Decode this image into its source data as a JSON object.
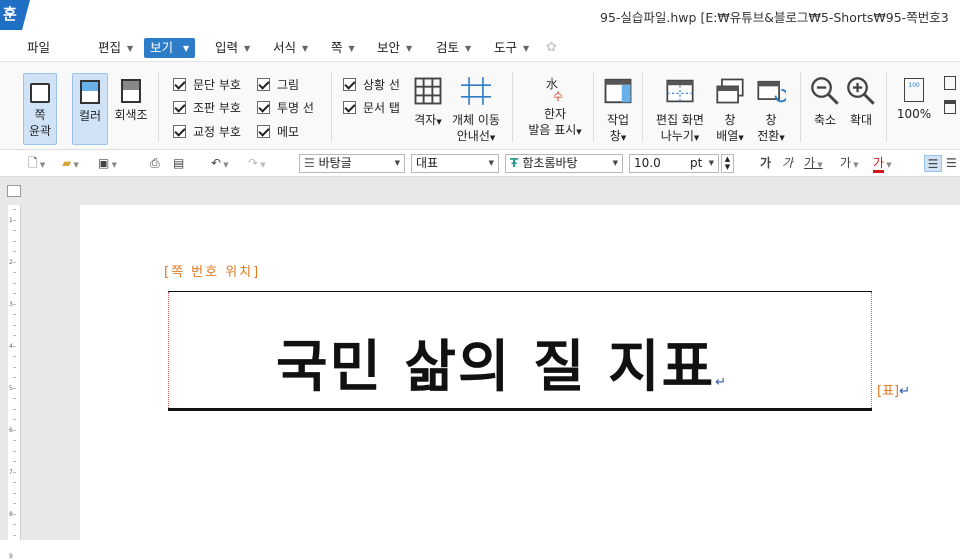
{
  "app": {
    "logo": "훈",
    "window_title": "95-실습파일.hwp [E:₩유튜브&블로그₩5-Shorts₩95-쪽번호3"
  },
  "menu": [
    "파일",
    "편집",
    "보기",
    "입력",
    "서식",
    "쪽",
    "보안",
    "검토",
    "도구"
  ],
  "ribbon": {
    "page_outline": [
      "쪽",
      "윤곽"
    ],
    "color": "컬러",
    "grayscale": "회색조",
    "checks_col1": [
      "문단 부호",
      "조판 부호",
      "교정 부호"
    ],
    "checks_col2": [
      "그림",
      "투명 선",
      "메모"
    ],
    "checks_col3": [
      "상황 선",
      "문서 탭"
    ],
    "grid": "격자",
    "object_move_guide": [
      "개체 이동",
      "안내선"
    ],
    "hanja_pronunciation": [
      "한자",
      "발음 표시"
    ],
    "task_pane": [
      "작업",
      "창"
    ],
    "split_screen": [
      "편집 화면",
      "나누기"
    ],
    "arrange_windows": [
      "창",
      "배열"
    ],
    "switch_window": [
      "창",
      "전환"
    ],
    "zoom_out": "축소",
    "zoom_in": "확대",
    "zoom_100": "100%",
    "hanja_icon_top": "水",
    "hanja_icon_bottom": "수"
  },
  "toolbar": {
    "style": "바탕글",
    "lang": "대표",
    "font": "함초롬바탕",
    "size": "10.0",
    "unit": "pt",
    "format_glyphs": [
      "가",
      "가",
      "가",
      "가",
      "가"
    ]
  },
  "document": {
    "page_number_field": "[쪽 번호 위치]",
    "title": "국민 삶의 질 지표",
    "table_marker": "[표]",
    "return_mark": "↵"
  },
  "ruler_numbers": [
    "1",
    "2",
    "3",
    "4",
    "5",
    "6",
    "7",
    "8",
    "9"
  ]
}
